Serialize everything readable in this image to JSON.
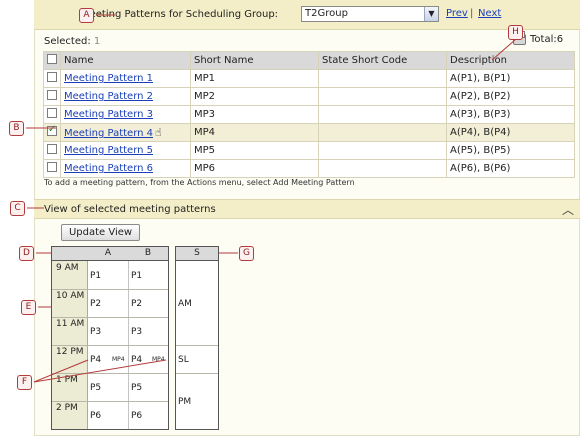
{
  "header": {
    "label": "Meeting Patterns for Scheduling Group:",
    "group": "T2Group",
    "prev": "Prev",
    "separator": "|",
    "next": "Next"
  },
  "selected": {
    "label": "Selected:",
    "count": "1"
  },
  "total": "Total:6",
  "table": {
    "columns": [
      "Name",
      "Short Name",
      "State Short Code",
      "Description"
    ],
    "rows": [
      {
        "name": "Meeting Pattern 1",
        "short": "MP1",
        "state": "",
        "desc": "A(P1), B(P1)"
      },
      {
        "name": "Meeting Pattern 2",
        "short": "MP2",
        "state": "",
        "desc": "A(P2), B(P2)"
      },
      {
        "name": "Meeting Pattern 3",
        "short": "MP3",
        "state": "",
        "desc": "A(P3), B(P3)"
      },
      {
        "name": "Meeting Pattern 4",
        "short": "MP4",
        "state": "",
        "desc": "A(P4), B(P4)"
      },
      {
        "name": "Meeting Pattern 5",
        "short": "MP5",
        "state": "",
        "desc": "A(P5), B(P5)"
      },
      {
        "name": "Meeting Pattern 6",
        "short": "MP6",
        "state": "",
        "desc": "A(P6), B(P6)"
      }
    ]
  },
  "hint": "To add a meeting pattern, from the Actions menu, select Add Meeting Pattern",
  "view": {
    "title": "View of selected meeting patterns",
    "update_button": "Update View"
  },
  "calendar": {
    "col_a": "A",
    "col_b": "B",
    "col_s": "S",
    "times": [
      "9 AM",
      "10 AM",
      "11 AM",
      "12 PM",
      "1 PM",
      "2 PM"
    ],
    "a": [
      "P1",
      "P2",
      "P3",
      "P4",
      "P5",
      "P6"
    ],
    "b": [
      "P1",
      "P2",
      "P3",
      "P4",
      "P5",
      "P6"
    ],
    "mp4_tag": "MP4",
    "s": [
      "AM",
      "SL",
      "PM"
    ]
  },
  "callouts": [
    "A",
    "B",
    "C",
    "D",
    "E",
    "F",
    "G",
    "H"
  ]
}
